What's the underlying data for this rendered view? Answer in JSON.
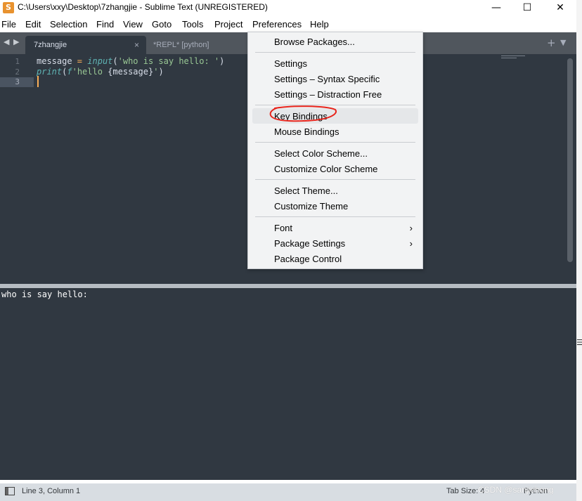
{
  "window": {
    "title": "C:\\Users\\xxy\\Desktop\\7zhangjie - Sublime Text (UNREGISTERED)",
    "controls": {
      "minimize": "—",
      "maximize": "☐",
      "close": "✕"
    }
  },
  "menubar": [
    "File",
    "Edit",
    "Selection",
    "Find",
    "View",
    "Goto",
    "Tools",
    "Project",
    "Preferences",
    "Help"
  ],
  "tabs": {
    "nav_left": "◀",
    "nav_right": "▶",
    "active": {
      "label": "7zhangjie",
      "close": "×"
    },
    "inactive": {
      "label": "*REPL* [python]"
    },
    "plus": "+",
    "menu": "▼"
  },
  "editor": {
    "line_numbers": [
      "1",
      "2",
      "3"
    ],
    "current_line": 3,
    "code": {
      "line1": {
        "var": "message",
        "op": " = ",
        "fn": "input",
        "open": "(",
        "str": "'who is say hello: '",
        "close": ")"
      },
      "line2": {
        "fn": "print",
        "open": "(",
        "fprefix": "f",
        "str": "'hello ",
        "interp": "{message}",
        "strend": "'",
        "close": ")"
      }
    }
  },
  "output": {
    "text": "who is say hello:"
  },
  "preferences_menu": {
    "items": [
      {
        "label": "Browse Packages..."
      },
      {
        "label": "Settings"
      },
      {
        "label": "Settings – Syntax Specific"
      },
      {
        "label": "Settings – Distraction Free"
      },
      {
        "label": "Key Bindings",
        "hovered": true,
        "circled": true
      },
      {
        "label": "Mouse Bindings"
      },
      {
        "label": "Select Color Scheme..."
      },
      {
        "label": "Customize Color Scheme"
      },
      {
        "label": "Select Theme..."
      },
      {
        "label": "Customize Theme"
      },
      {
        "label": "Font",
        "submenu": true
      },
      {
        "label": "Package Settings",
        "submenu": true
      },
      {
        "label": "Package Control"
      }
    ],
    "submenu_arrow": "›"
  },
  "statusbar": {
    "position": "Line 3, Column 1",
    "tab_size": "Tab Size: 4",
    "syntax": "Python"
  },
  "watermark": "CSDN @sanjiehong",
  "colors": {
    "editor_bg": "#303841",
    "tabbar_bg": "#50565d",
    "annotation_circle": "#e8241b",
    "cursor": "#f9ae58",
    "string": "#99c794",
    "function": "#5fb4b4"
  }
}
